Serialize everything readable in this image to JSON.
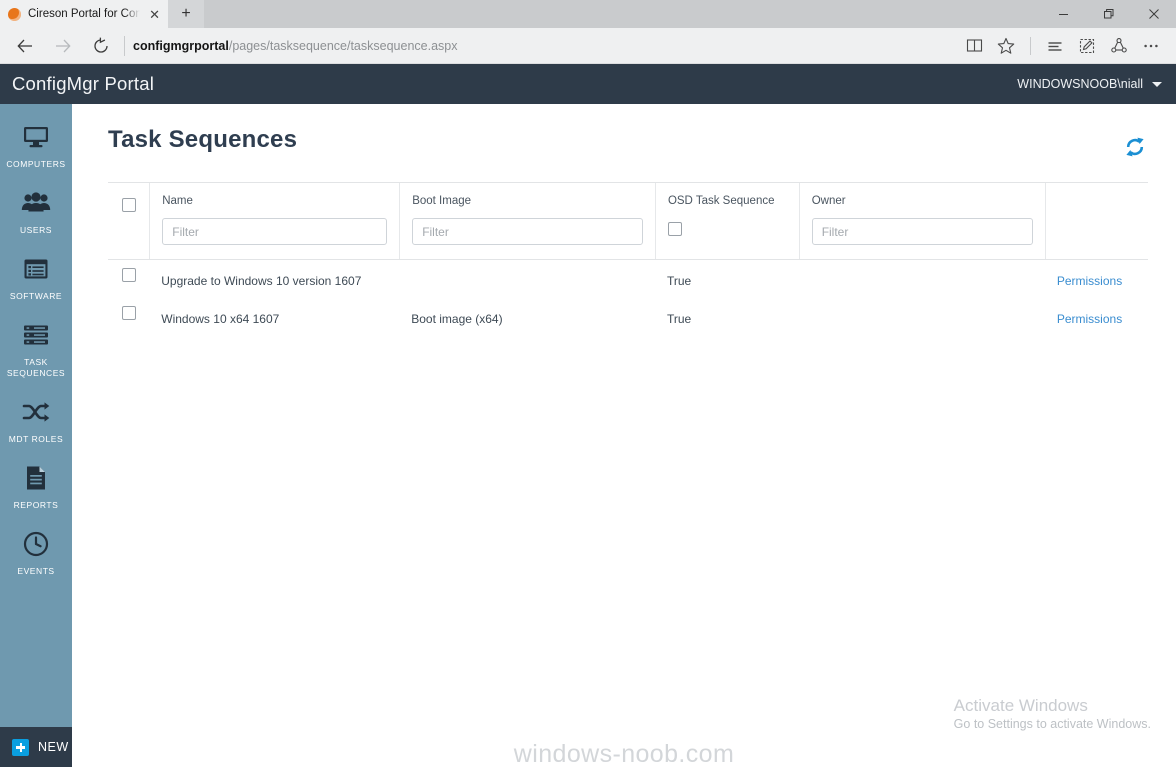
{
  "browser": {
    "tab": {
      "title": "Cireson Portal for Confi",
      "favicon": "cireson-circle-icon",
      "close_label": "✕"
    },
    "new_tab_label": "+",
    "window_controls": {
      "minimize": "–",
      "restore": "❐",
      "close": "✕"
    },
    "nav": {
      "back": "back-arrow",
      "forward": "forward-arrow",
      "refresh": "refresh-arrow"
    },
    "address": {
      "host": "configmgrportal",
      "path": "/pages/tasksequence/tasksequence.aspx"
    },
    "toolbar_icons": [
      "reading-view-icon",
      "favorites-star-icon",
      "hub-icon",
      "web-note-icon",
      "share-icon",
      "more-icon"
    ]
  },
  "header": {
    "brand": "ConfigMgr Portal",
    "user": "WINDOWSNOOB\\niall"
  },
  "sidebar": {
    "items": [
      {
        "label": "Computers",
        "icon": "monitor-icon"
      },
      {
        "label": "Users",
        "icon": "users-icon"
      },
      {
        "label": "Software",
        "icon": "software-window-icon"
      },
      {
        "label": "Task Sequences",
        "icon": "server-stack-icon"
      },
      {
        "label": "MDT Roles",
        "icon": "shuffle-icon"
      },
      {
        "label": "Reports",
        "icon": "document-icon"
      },
      {
        "label": "Events",
        "icon": "clock-icon"
      }
    ],
    "new_button": {
      "label": "NEW",
      "icon": "plus-square-icon"
    }
  },
  "page": {
    "title": "Task Sequences",
    "refresh_icon": "sync-refresh-icon",
    "accent_color": "#1b8fd3"
  },
  "grid": {
    "columns": [
      {
        "key": "select",
        "label": "",
        "filter": "checkbox"
      },
      {
        "key": "name",
        "label": "Name",
        "filter": "text",
        "placeholder": "Filter"
      },
      {
        "key": "boot_image",
        "label": "Boot Image",
        "filter": "text",
        "placeholder": "Filter"
      },
      {
        "key": "osd",
        "label": "OSD Task Sequence",
        "filter": "checkbox"
      },
      {
        "key": "owner",
        "label": "Owner",
        "filter": "text",
        "placeholder": "Filter"
      },
      {
        "key": "permissions",
        "label": "",
        "filter": "none"
      }
    ],
    "rows": [
      {
        "name": "Upgrade to Windows 10 version 1607",
        "boot_image": "",
        "osd": "True",
        "owner": "",
        "permissions": "Permissions"
      },
      {
        "name": "Windows 10 x64 1607",
        "boot_image": "Boot image (x64)",
        "osd": "True",
        "owner": "",
        "permissions": "Permissions"
      }
    ]
  },
  "watermarks": {
    "activate_title": "Activate Windows",
    "activate_sub": "Go to Settings to activate Windows.",
    "site": "windows-noob.com"
  }
}
